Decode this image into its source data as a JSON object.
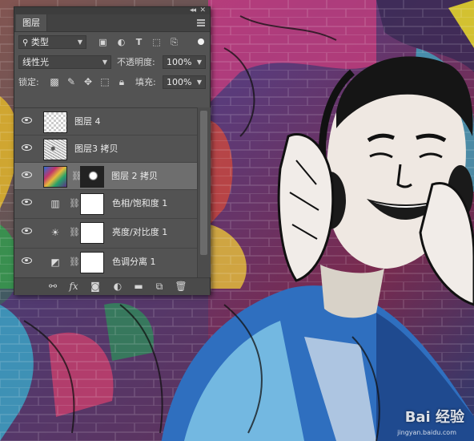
{
  "panel": {
    "tab_title": "图层",
    "collapse_glyph": "◂◂",
    "close_glyph": "✕",
    "filter": {
      "kind_label": "类型",
      "kind_icon": "search-icon",
      "icons": [
        "image-filter-icon",
        "adjustment-filter-icon",
        "type-filter-icon",
        "shape-filter-icon",
        "smart-object-filter-icon"
      ]
    },
    "blend": {
      "mode": "线性光",
      "opacity_label": "不透明度:",
      "opacity_value": "100%"
    },
    "lock": {
      "label": "锁定:",
      "icons": [
        "lock-transparent-icon",
        "lock-image-icon",
        "lock-position-icon",
        "lock-artboard-icon",
        "lock-all-icon"
      ],
      "fill_label": "填充:",
      "fill_value": "100%"
    },
    "layers": [
      {
        "name": "图层 4",
        "visible": true,
        "selected": false,
        "thumb": "checker"
      },
      {
        "name": "图层3 拷贝",
        "visible": true,
        "selected": false,
        "thumb": "sketch"
      },
      {
        "name": "图层 2 拷贝",
        "visible": true,
        "selected": true,
        "thumb": "art",
        "mask": true
      },
      {
        "name": "色相/饱和度 1",
        "visible": true,
        "selected": false,
        "adjustment": "hue-saturation-icon"
      },
      {
        "name": "亮度/对比度 1",
        "visible": true,
        "selected": false,
        "adjustment": "brightness-contrast-icon"
      },
      {
        "name": "色调分离 1",
        "visible": true,
        "selected": false,
        "adjustment": "posterize-icon"
      }
    ],
    "bottom_icons": [
      "link-layers-icon",
      "fx-icon",
      "add-mask-icon",
      "new-adjustment-icon",
      "new-group-icon",
      "new-layer-icon",
      "delete-icon"
    ],
    "fx_label": "fx"
  },
  "watermark": {
    "text": "Bai 经验",
    "sub": "jingyan.baidu.com"
  }
}
